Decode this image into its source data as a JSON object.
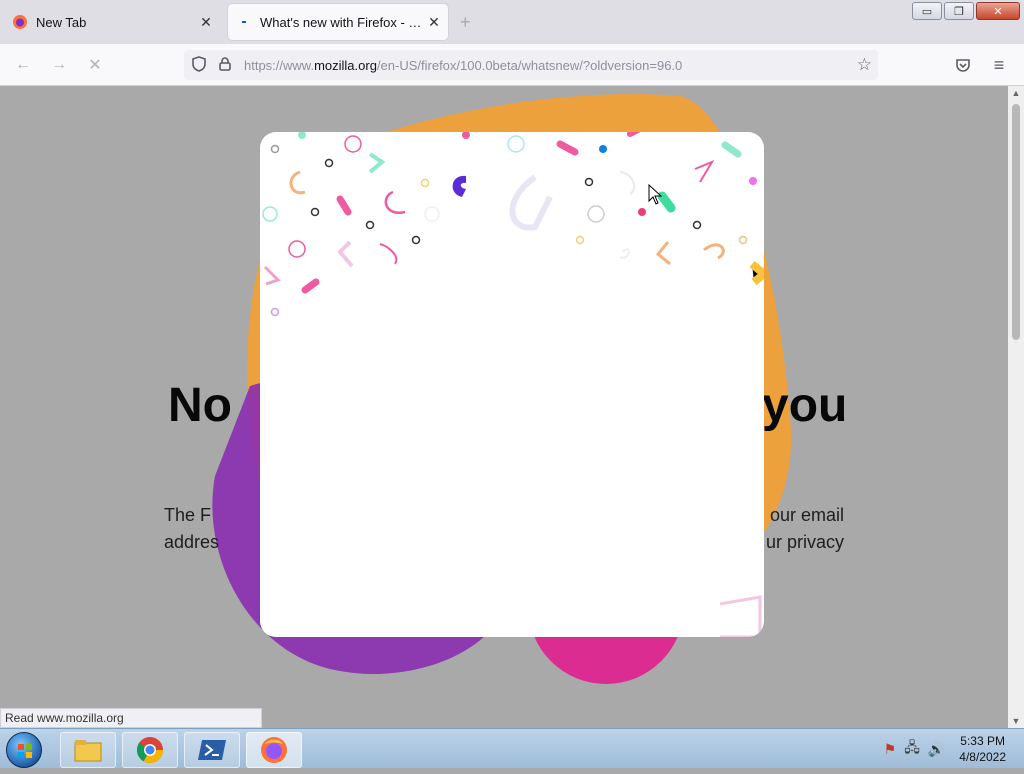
{
  "tabs": [
    {
      "title": "New Tab",
      "active": false
    },
    {
      "title": "What's new with Firefox - More",
      "active": true
    }
  ],
  "window_buttons": {
    "minimize": "▭",
    "restore": "❐",
    "close": "✕"
  },
  "url": {
    "prefix": "https://www.",
    "host": "mozilla.org",
    "path": "/en-US/firefox/100.0beta/whatsnew/?oldversion=96.0"
  },
  "page": {
    "headline_left": "No",
    "headline_right": "you",
    "para_left_1": "The F",
    "para_left_2": "addres",
    "para_right_1": "our email",
    "para_right_2": "ur privacy"
  },
  "status_text": "Read www.mozilla.org",
  "clock": {
    "time": "5:33 PM",
    "date": "4/8/2022"
  },
  "colors": {
    "tab_strip": "#dedee4",
    "overlay_gray": "#a9a9a9",
    "blob_orange": "#f8a029",
    "blob_purple": "#8a2cb0",
    "blob_pink": "#e01e8f",
    "confetti_purple": "#5b2bd8",
    "confetti_green": "#3fdca0",
    "confetti_pink": "#ef3b7a"
  }
}
